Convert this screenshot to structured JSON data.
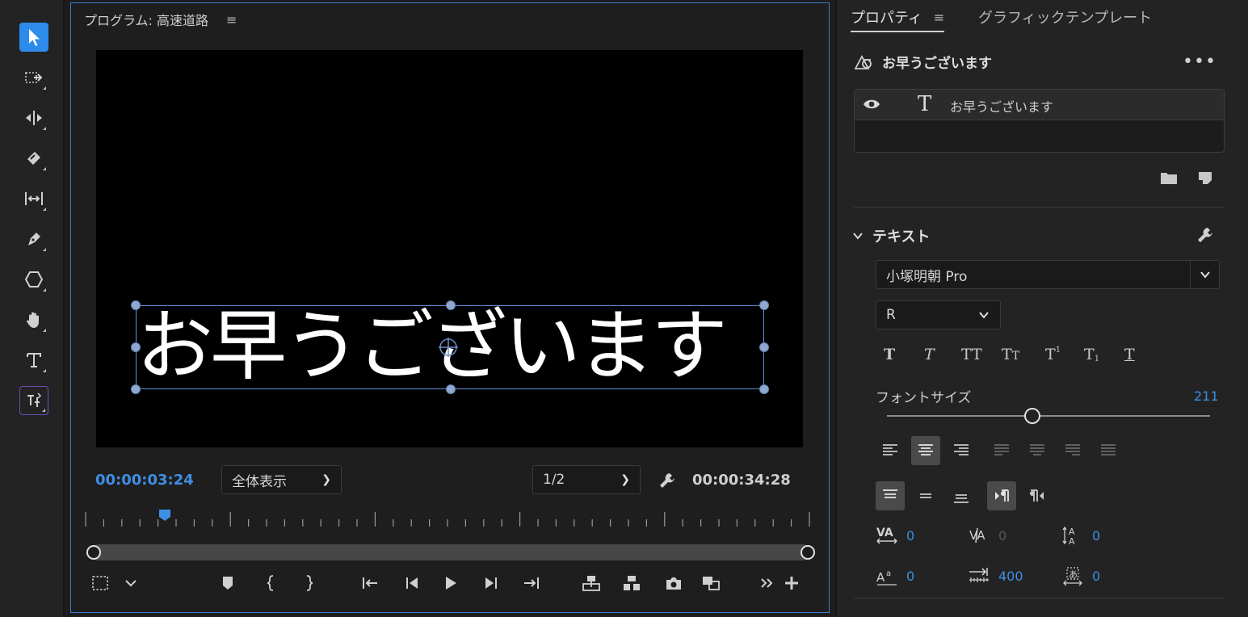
{
  "monitor": {
    "title": "プログラム: 高速道路",
    "menu_glyph": "≡",
    "overlay_text": "お早うございます",
    "timecode_current": "00:00:03:24",
    "timecode_duration": "00:00:34:28",
    "zoom_label": "全体表示",
    "resolution_label": "1/2"
  },
  "properties": {
    "tab_active": "プロパティ",
    "tab_other": "グラフィックテンプレート",
    "menu_glyph": "≡",
    "layer_name": "お早うございます",
    "more_glyph": "•••",
    "layer_row_name": "お早うございます",
    "text_section_label": "テキスト",
    "font_family": "小塚明朝 Pro",
    "font_style": "R",
    "font_size_label": "フォントサイズ",
    "font_size_value": "211",
    "font_size_fraction": 0.45,
    "tracking_value": "0",
    "kerning_value": "0",
    "leading_value": "0",
    "baseline_value": "0",
    "tabwidth_value": "400",
    "tsume_value": "0"
  },
  "colors": {
    "accent_blue": "#2d8ceb",
    "value_blue": "#3f8fe4",
    "selection_outline": "#5d8fd8",
    "panel_bg": "#232323",
    "video_bg": "#000000"
  },
  "icons": {
    "tools": [
      "selection-icon",
      "track-select-forward-icon",
      "ripple-edit-icon",
      "razor-icon",
      "slip-icon",
      "pen-icon",
      "shape-icon",
      "hand-icon",
      "type-icon",
      "vertical-type-icon"
    ],
    "transport": [
      "safe-margins-icon",
      "add-marker-icon",
      "mark-in-icon",
      "mark-out-icon",
      "go-to-in-icon",
      "step-back-icon",
      "play-icon",
      "step-forward-icon",
      "go-to-out-icon",
      "lift-icon",
      "extract-icon",
      "export-frame-icon",
      "comparison-view-icon",
      "add-button-icon"
    ]
  }
}
